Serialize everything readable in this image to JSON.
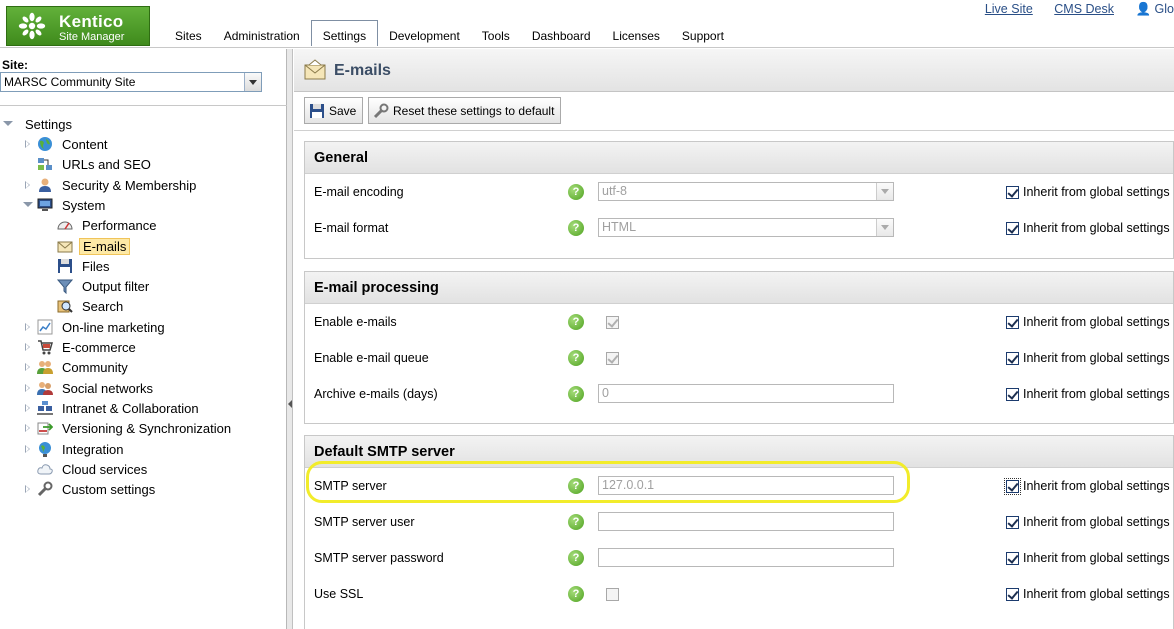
{
  "header": {
    "logo_title": "Kentico",
    "logo_subtitle": "Site Manager",
    "links": {
      "live_site": "Live Site",
      "cms_desk": "CMS Desk",
      "user": "Glo"
    },
    "tabs": [
      "Sites",
      "Administration",
      "Settings",
      "Development",
      "Tools",
      "Dashboard",
      "Licenses",
      "Support"
    ],
    "active_tab": "Settings"
  },
  "left": {
    "site_label": "Site:",
    "site_value": "MARSC Community Site",
    "tree": {
      "root": "Settings",
      "items": [
        {
          "label": "Content",
          "icon": "globe-icon"
        },
        {
          "label": "URLs and SEO",
          "icon": "network-icon"
        },
        {
          "label": "Security & Membership",
          "icon": "user-icon"
        },
        {
          "label": "System",
          "icon": "monitor-icon"
        },
        {
          "label": "Performance",
          "icon": "gauge-icon"
        },
        {
          "label": "E-mails",
          "icon": "envelope-icon"
        },
        {
          "label": "Files",
          "icon": "floppy-icon"
        },
        {
          "label": "Output filter",
          "icon": "funnel-icon"
        },
        {
          "label": "Search",
          "icon": "search-icon"
        },
        {
          "label": "On-line marketing",
          "icon": "chart-icon"
        },
        {
          "label": "E-commerce",
          "icon": "cart-icon"
        },
        {
          "label": "Community",
          "icon": "people-icon"
        },
        {
          "label": "Social networks",
          "icon": "social-icon"
        },
        {
          "label": "Intranet & Collaboration",
          "icon": "intranet-icon"
        },
        {
          "label": "Versioning & Synchronization",
          "icon": "sync-icon"
        },
        {
          "label": "Integration",
          "icon": "integration-icon"
        },
        {
          "label": "Cloud services",
          "icon": "cloud-icon"
        },
        {
          "label": "Custom settings",
          "icon": "wrench-icon"
        }
      ]
    }
  },
  "main": {
    "title": "E-mails",
    "toolbar": {
      "save": "Save",
      "reset": "Reset these settings to default"
    },
    "inherit_label": "Inherit from global settings",
    "sections": [
      {
        "title": "General",
        "rows": [
          {
            "label": "E-mail encoding",
            "value": "utf-8"
          },
          {
            "label": "E-mail format",
            "value": "HTML"
          }
        ]
      },
      {
        "title": "E-mail processing",
        "rows": [
          {
            "label": "Enable e-mails"
          },
          {
            "label": "Enable e-mail queue"
          },
          {
            "label": "Archive e-mails (days)",
            "value": "0"
          }
        ]
      },
      {
        "title": "Default SMTP server",
        "rows": [
          {
            "label": "SMTP server",
            "value": "127.0.0.1"
          },
          {
            "label": "SMTP server user",
            "value": ""
          },
          {
            "label": "SMTP server password",
            "value": ""
          },
          {
            "label": "Use SSL"
          }
        ]
      }
    ],
    "help_glyph": "?"
  },
  "colors": {
    "brand_green": "#4e9f27",
    "highlight": "#f2ec2a",
    "title_blue": "#3c4e66"
  }
}
